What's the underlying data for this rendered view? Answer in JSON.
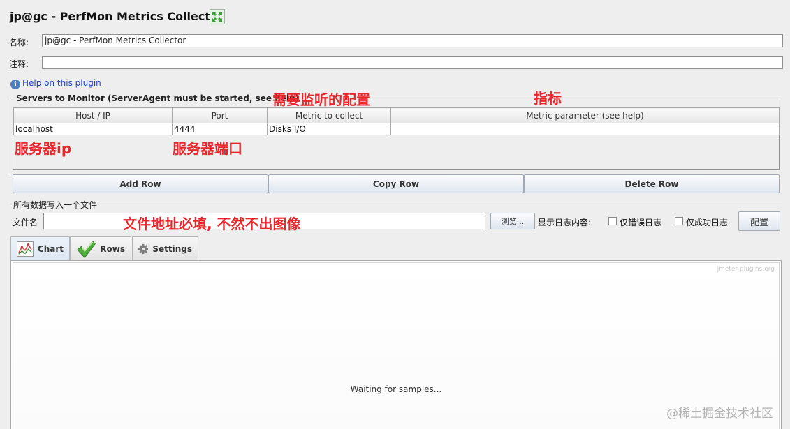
{
  "window": {
    "title": "jp@gc - PerfMon Metrics Collector"
  },
  "form": {
    "name_label": "名称:",
    "name_value": "jp@gc - PerfMon Metrics Collector",
    "comment_label": "注释:",
    "comment_value": ""
  },
  "help": {
    "link_text": "Help on this plugin",
    "icon": "info-icon"
  },
  "servers": {
    "group_title": "Servers to Monitor (ServerAgent must be started, see help)",
    "columns": [
      "Host / IP",
      "Port",
      "Metric to collect",
      "Metric parameter (see help)"
    ],
    "rows": [
      {
        "host": "localhost",
        "port": "4444",
        "metric": "Disks I/O",
        "param": ""
      }
    ],
    "buttons": {
      "add": "Add Row",
      "copy": "Copy Row",
      "delete": "Delete Row"
    }
  },
  "file_section": {
    "title": "所有数据写入一个文件",
    "filename_label": "文件名",
    "filename_value": "",
    "browse_label": "浏览...",
    "log_label": "显示日志内容:",
    "errors_only_label": "仅错误日志",
    "success_only_label": "仅成功日志",
    "configure_label": "配置"
  },
  "tabs": [
    {
      "label": "Chart",
      "icon": "chart-icon",
      "active": true
    },
    {
      "label": "Rows",
      "icon": "checkmark-icon",
      "active": false
    },
    {
      "label": "Settings",
      "icon": "gear-icon",
      "active": false
    }
  ],
  "chart": {
    "site_label": "jmeter-plugins.org",
    "status_text": "Waiting for samples..."
  },
  "annotations": {
    "config_note": "需要监听的配置",
    "metric_note": "指标",
    "server_ip_note": "服务器ip",
    "server_port_note": "服务器端口",
    "file_note": "文件地址必填, 不然不出图像"
  },
  "watermark": {
    "text": "@稀土掘金技术社区"
  },
  "colors": {
    "annotation": "#e8262c",
    "link": "#1f3fd0"
  }
}
